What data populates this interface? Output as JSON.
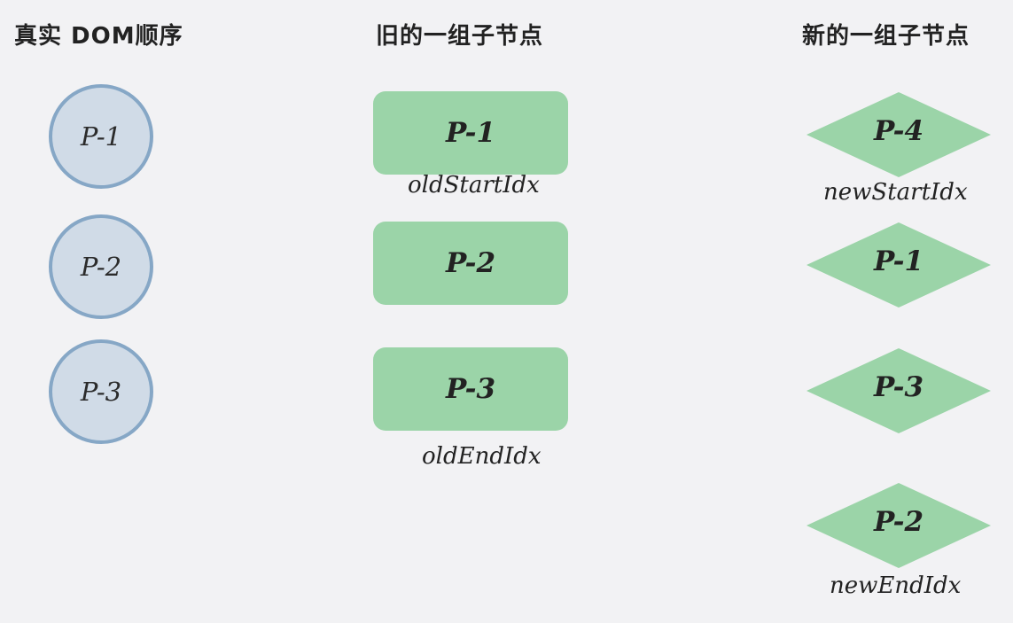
{
  "columns": {
    "real_dom": {
      "title": "真实 DOM顺序",
      "nodes": [
        "P-1",
        "P-2",
        "P-3"
      ]
    },
    "old_children": {
      "title": "旧的一组子节点",
      "nodes": [
        "P-1",
        "P-2",
        "P-3"
      ],
      "start_pointer": "oldStartIdx",
      "end_pointer": "oldEndIdx"
    },
    "new_children": {
      "title": "新的一组子节点",
      "nodes": [
        "P-4",
        "P-1",
        "P-3",
        "P-2"
      ],
      "start_pointer": "newStartIdx",
      "end_pointer": "newEndIdx"
    }
  },
  "colors": {
    "background": "#f2f2f4",
    "circle_fill": "#d0dbe7",
    "circle_stroke": "#86a7c6",
    "vnode_fill": "#9bd4a8"
  }
}
